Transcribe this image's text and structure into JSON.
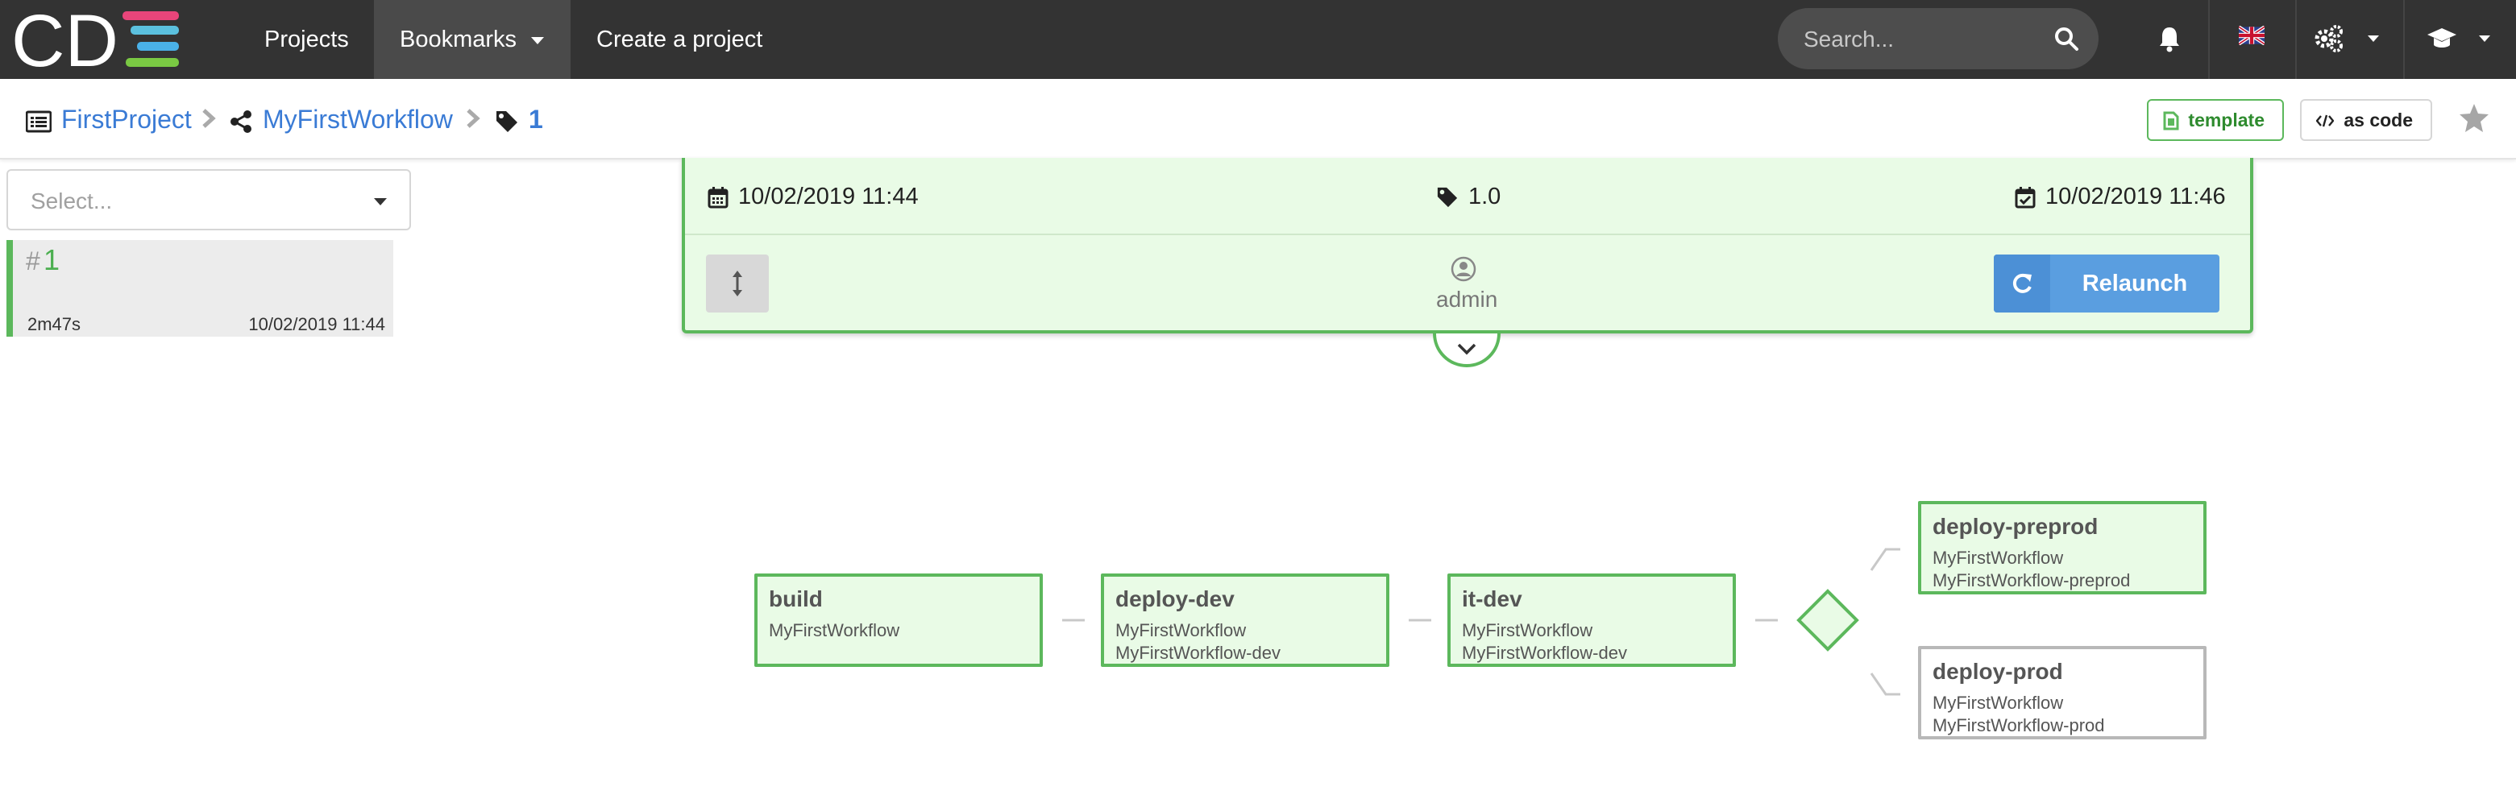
{
  "nav": {
    "logo_text": "CDS",
    "items": [
      {
        "label": "Projects"
      },
      {
        "label": "Bookmarks"
      },
      {
        "label": "Create a project"
      }
    ],
    "search_placeholder": "Search..."
  },
  "breadcrumb": {
    "project": "FirstProject",
    "workflow": "MyFirstWorkflow",
    "run": "1"
  },
  "actions": {
    "template_label": "template",
    "as_code_label": "as code"
  },
  "sidebar": {
    "select_placeholder": "Select...",
    "runs": [
      {
        "hash": "#",
        "number": "1",
        "duration": "2m47s",
        "date": "10/02/2019 11:44"
      }
    ]
  },
  "run_header": {
    "start_date": "10/02/2019 11:44",
    "version": "1.0",
    "end_date": "10/02/2019 11:46",
    "user": "admin",
    "relaunch_label": "Relaunch"
  },
  "graph": {
    "nodes": [
      {
        "name": "build",
        "lines": [
          "MyFirstWorkflow"
        ],
        "status": "success"
      },
      {
        "name": "deploy-dev",
        "lines": [
          "MyFirstWorkflow",
          "MyFirstWorkflow-dev"
        ],
        "status": "success"
      },
      {
        "name": "it-dev",
        "lines": [
          "MyFirstWorkflow",
          "MyFirstWorkflow-dev"
        ],
        "status": "success"
      },
      {
        "name": "deploy-preprod",
        "lines": [
          "MyFirstWorkflow",
          "MyFirstWorkflow-preprod"
        ],
        "status": "success"
      },
      {
        "name": "deploy-prod",
        "lines": [
          "MyFirstWorkflow",
          "MyFirstWorkflow-prod"
        ],
        "status": "not-run"
      }
    ]
  },
  "colors": {
    "success": "#5cb85c",
    "success_bg": "#e9fbe6",
    "link": "#3a7bd5",
    "primary": "#5a9ee0",
    "nav_bg": "#333333"
  },
  "icons": [
    "logo",
    "search-icon",
    "bell-icon",
    "uk-flag-icon",
    "gears-icon",
    "graduation-cap-icon",
    "list-icon",
    "share-icon",
    "tag-icon",
    "chevron-right-icon",
    "file-icon",
    "code-icon",
    "star-icon",
    "calendar-icon",
    "calendar-check-icon",
    "vertical-arrows-icon",
    "user-circle-icon",
    "refresh-icon",
    "chevron-down-icon",
    "fork-diamond-icon"
  ]
}
